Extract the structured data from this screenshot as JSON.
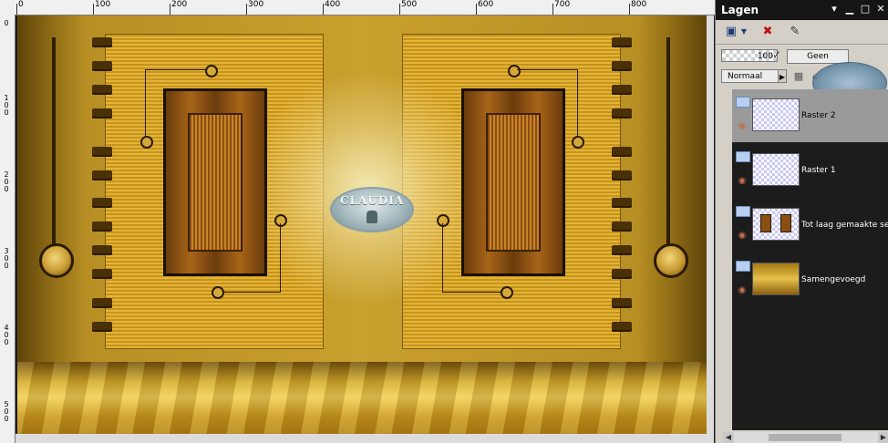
{
  "ruler": {
    "top_labels": [
      "0",
      "100",
      "200",
      "300",
      "400",
      "500",
      "600",
      "700",
      "800"
    ],
    "left_labels": [
      "0",
      "100",
      "200",
      "300",
      "400",
      "500"
    ]
  },
  "canvas": {
    "watermark": "CLAUDIA"
  },
  "layers_panel": {
    "title": "Lagen",
    "opacity": "100",
    "blend_none": "Geen",
    "blend_mode": "Normaal",
    "layers": [
      {
        "name": "Raster 2",
        "selected": true
      },
      {
        "name": "Raster 1",
        "selected": false
      },
      {
        "name": "Tot laag gemaakte selectie",
        "selected": false
      },
      {
        "name": "Samengevoegd",
        "selected": false
      }
    ]
  },
  "icons": [
    "pin-icon",
    "close-icon",
    "minimize-icon",
    "maximize-icon",
    "new-layer-icon",
    "delete-layer-icon",
    "dropdown-icon",
    "brush-icon",
    "lock-icon",
    "link-icon",
    "eye-icon"
  ],
  "colors": {
    "panel_title_bg": "#151515",
    "panel_bg": "#d4d0c8",
    "selected_layer": "#9a9a9a"
  }
}
